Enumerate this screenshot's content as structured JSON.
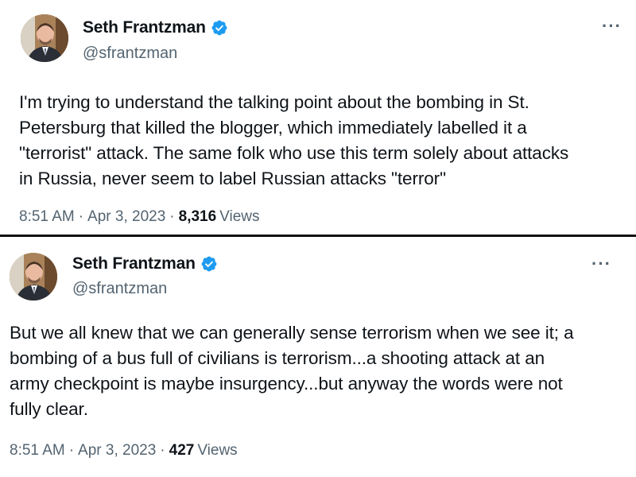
{
  "tweets": [
    {
      "author": {
        "name": "Seth Frantzman",
        "handle": "@sfrantzman",
        "verified": true
      },
      "more_label": "···",
      "text": "I'm trying to understand the talking point about the bombing in St.\nPetersburg that killed the blogger, which immediately labelled it a\n\"terrorist\" attack. The same folk who use this term solely about attacks\nin Russia, never seem to label Russian attacks \"terror\"",
      "time": "8:51 AM",
      "separator": "·",
      "date": "Apr 3, 2023",
      "views_count": "8,316",
      "views_label": "Views"
    },
    {
      "author": {
        "name": "Seth Frantzman",
        "handle": "@sfrantzman",
        "verified": true
      },
      "more_label": "···",
      "text": "But we all knew that we can generally sense terrorism when we see it; a\nbombing of a bus full of civilians is terrorism...a shooting attack at an\narmy checkpoint is maybe insurgency...but anyway the words were not\nfully clear.",
      "time": "8:51 AM",
      "separator": "·",
      "date": "Apr 3, 2023",
      "views_count": "427",
      "views_label": "Views"
    }
  ],
  "colors": {
    "verified_blue": "#1d9bf0",
    "secondary_text": "#536471",
    "primary_text": "#0f1419"
  }
}
